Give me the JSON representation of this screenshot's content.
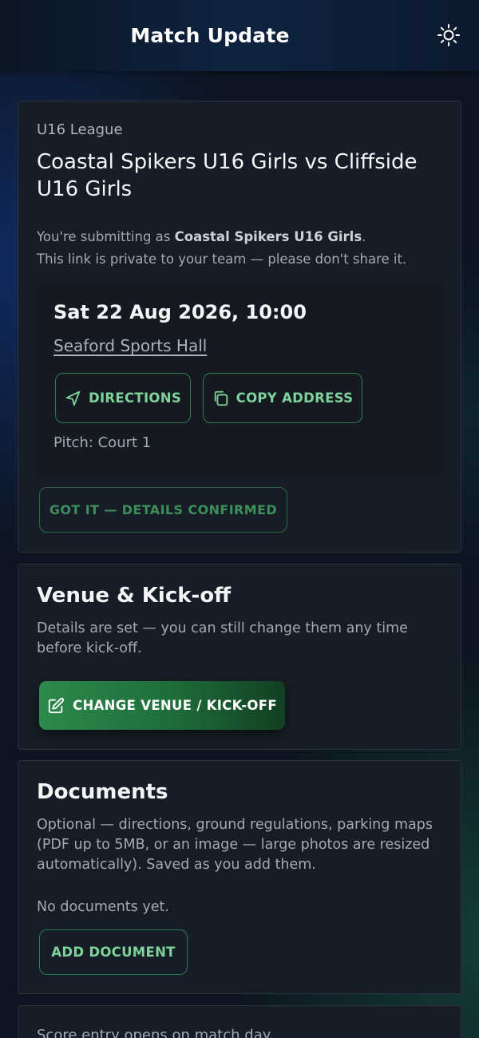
{
  "header": {
    "title": "Match Update",
    "theme_icon": "sun-icon"
  },
  "match_card": {
    "league": "U16 League",
    "title": "Coastal Spikers U16 Girls vs Cliffside U16 Girls",
    "submitting_prefix": "You're submitting as ",
    "submitting_team": "Coastal Spikers U16 Girls",
    "submitting_suffix": ".",
    "privacy_note": "This link is private to your team — please don't share it.",
    "datetime": "Sat 22 Aug 2026, 10:00",
    "venue": "Seaford Sports Hall",
    "directions_label": "DIRECTIONS",
    "copy_address_label": "COPY ADDRESS",
    "pitch": "Pitch: Court 1",
    "confirm_label": "GOT IT — DETAILS CONFIRMED"
  },
  "venue_section": {
    "title": "Venue & Kick-off",
    "description": "Details are set — you can still change them any time before kick-off.",
    "change_label": "CHANGE VENUE / KICK-OFF"
  },
  "documents_section": {
    "title": "Documents",
    "description": "Optional — directions, ground regulations, parking maps (PDF up to 5MB, or an image — large photos are resized automatically). Saved as you add them.",
    "empty_text": "No documents yet.",
    "add_label": "ADD DOCUMENT"
  },
  "score_section": {
    "note": "Score entry opens on match day."
  },
  "colors": {
    "accent_green": "#7fd29a",
    "button_green": "#2c8a4d",
    "card_bg": "#171d26",
    "page_bg": "#0c1521"
  }
}
